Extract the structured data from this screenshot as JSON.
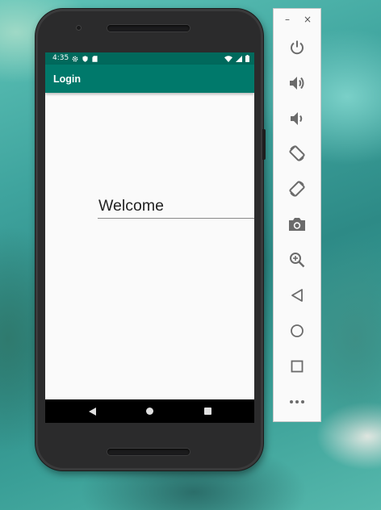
{
  "status_bar": {
    "time": "4:35"
  },
  "app_bar": {
    "title": "Login"
  },
  "form": {
    "welcome_text": "Welcome"
  },
  "emulator_toolbar": {
    "minimize_label": "–",
    "close_label": "×",
    "tools": [
      "power",
      "volume-up",
      "volume-down",
      "rotate-left",
      "rotate-right",
      "take-screenshot",
      "zoom",
      "back",
      "home",
      "overview",
      "more"
    ]
  },
  "colors": {
    "status_bar": "#00695c",
    "app_bar": "#00796b",
    "toolbar_icon": "#6b6b6b"
  }
}
